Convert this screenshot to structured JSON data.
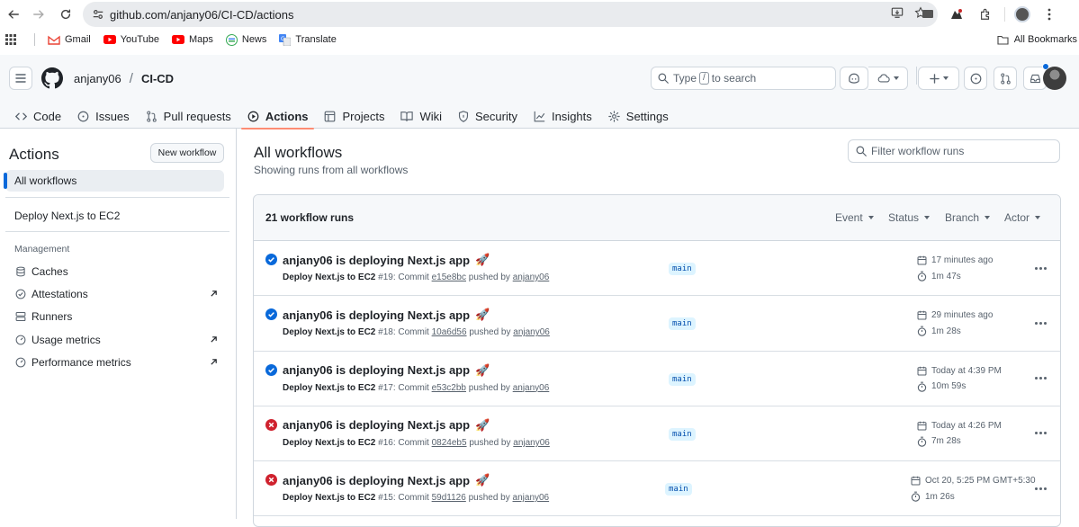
{
  "browser": {
    "url": "github.com/anjany06/CI-CD/actions",
    "bookmarks": [
      {
        "label": "Gmail",
        "icon": "gmail-icon"
      },
      {
        "label": "YouTube",
        "icon": "youtube-icon"
      },
      {
        "label": "Maps",
        "icon": "maps-icon"
      },
      {
        "label": "News",
        "icon": "news-icon"
      },
      {
        "label": "Translate",
        "icon": "translate-icon"
      }
    ],
    "all_bookmarks": "All Bookmarks"
  },
  "header": {
    "owner": "anjany06",
    "separator": "/",
    "repo": "CI-CD",
    "search_prefix": "Type",
    "search_key": "/",
    "search_suffix": "to search"
  },
  "tabs": [
    {
      "label": "Code",
      "icon": "code-icon",
      "active": false
    },
    {
      "label": "Issues",
      "icon": "issue-icon",
      "active": false
    },
    {
      "label": "Pull requests",
      "icon": "pull-request-icon",
      "active": false
    },
    {
      "label": "Actions",
      "icon": "play-icon",
      "active": true
    },
    {
      "label": "Projects",
      "icon": "table-icon",
      "active": false
    },
    {
      "label": "Wiki",
      "icon": "book-icon",
      "active": false
    },
    {
      "label": "Security",
      "icon": "shield-icon",
      "active": false
    },
    {
      "label": "Insights",
      "icon": "graph-icon",
      "active": false
    },
    {
      "label": "Settings",
      "icon": "gear-icon",
      "active": false
    }
  ],
  "sidebar": {
    "title": "Actions",
    "new_workflow": "New workflow",
    "all_workflows": "All workflows",
    "workflow": "Deploy Next.js to EC2",
    "management_heading": "Management",
    "management": [
      {
        "label": "Caches",
        "icon": "database-icon",
        "external": false
      },
      {
        "label": "Attestations",
        "icon": "verified-icon",
        "external": true
      },
      {
        "label": "Runners",
        "icon": "server-icon",
        "external": false
      },
      {
        "label": "Usage metrics",
        "icon": "meter-icon",
        "external": true
      },
      {
        "label": "Performance metrics",
        "icon": "meter-icon",
        "external": true
      }
    ]
  },
  "main": {
    "title": "All workflows",
    "subtitle": "Showing runs from all workflows",
    "filter_placeholder": "Filter workflow runs",
    "runs_count": "21 workflow runs",
    "filters": [
      "Event",
      "Status",
      "Branch",
      "Actor"
    ],
    "runs": [
      {
        "status": "success",
        "title": "anjany06 is deploying Next.js app",
        "emoji": "🚀",
        "workflow": "Deploy Next.js to EC2",
        "run": "#19: Commit",
        "commit": "e15e8bc",
        "pushed_by": "pushed by",
        "actor": "anjany06",
        "branch": "main",
        "time": "17 minutes ago",
        "duration": "1m 47s"
      },
      {
        "status": "success",
        "title": "anjany06 is deploying Next.js app",
        "emoji": "🚀",
        "workflow": "Deploy Next.js to EC2",
        "run": "#18: Commit",
        "commit": "10a6d56",
        "pushed_by": "pushed by",
        "actor": "anjany06",
        "branch": "main",
        "time": "29 minutes ago",
        "duration": "1m 28s"
      },
      {
        "status": "success",
        "title": "anjany06 is deploying Next.js app",
        "emoji": "🚀",
        "workflow": "Deploy Next.js to EC2",
        "run": "#17: Commit",
        "commit": "e53c2bb",
        "pushed_by": "pushed by",
        "actor": "anjany06",
        "branch": "main",
        "time": "Today at 4:39 PM",
        "duration": "10m 59s"
      },
      {
        "status": "failure",
        "title": "anjany06 is deploying Next.js app",
        "emoji": "🚀",
        "workflow": "Deploy Next.js to EC2",
        "run": "#16: Commit",
        "commit": "0824eb5",
        "pushed_by": "pushed by",
        "actor": "anjany06",
        "branch": "main",
        "time": "Today at 4:26 PM",
        "duration": "7m 28s"
      },
      {
        "status": "failure",
        "title": "anjany06 is deploying Next.js app",
        "emoji": "🚀",
        "workflow": "Deploy Next.js to EC2",
        "run": "#15: Commit",
        "commit": "59d1126",
        "pushed_by": "pushed by",
        "actor": "anjany06",
        "branch": "main",
        "time": "Oct 20, 5:25 PM GMT+5:30",
        "duration": "1m 26s"
      }
    ]
  },
  "colors": {
    "success": "#0969da",
    "failure": "#cf222e",
    "active_tab_underline": "#fd8c73",
    "branch_bg": "#ddf4ff",
    "branch_fg": "#0550ae"
  }
}
